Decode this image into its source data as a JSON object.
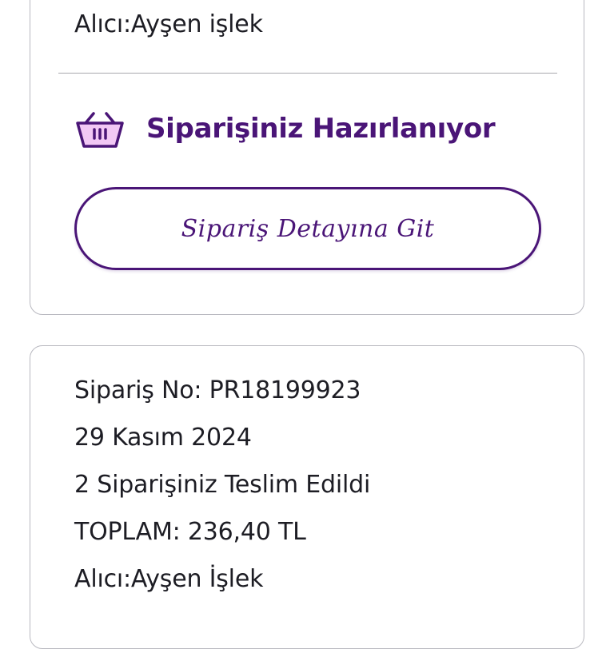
{
  "order_card_1": {
    "recipient": "Alıcı:Ayşen işlek",
    "status": "Siparişiniz Hazırlanıyor",
    "detail_button_label": "Sipariş Detayına Git"
  },
  "order_card_2": {
    "order_number": "Sipariş No: PR18199923",
    "date": "29 Kasım 2024",
    "delivery_status": "2 Siparişiniz Teslim Edildi",
    "total": "TOPLAM: 236,40 TL",
    "recipient": "Alıcı:Ayşen İşlek"
  },
  "colors": {
    "accent": "#4a1577",
    "basket_fill": "#f2c8f5",
    "card_border": "#b9b9c0",
    "text": "#1d1d24"
  },
  "icons": {
    "status_icon": "shopping-basket-icon"
  }
}
